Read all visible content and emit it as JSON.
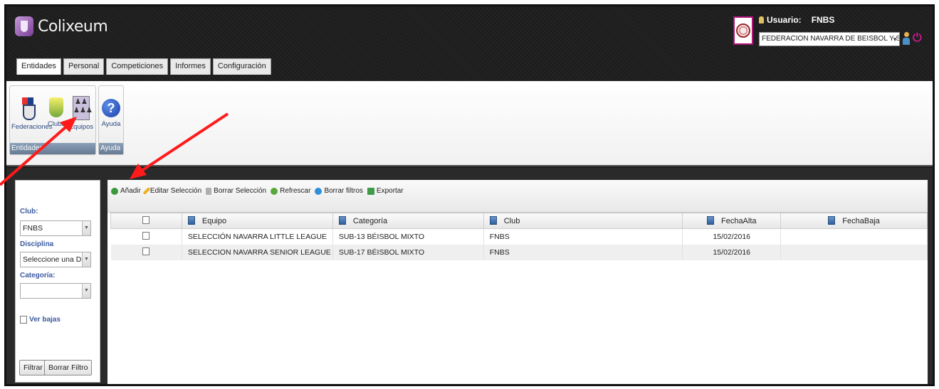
{
  "app": {
    "name": "Colixeum"
  },
  "tabs": [
    {
      "label": "Entidades"
    },
    {
      "label": "Personal"
    },
    {
      "label": "Competiciones"
    },
    {
      "label": "Informes"
    },
    {
      "label": "Configuración"
    }
  ],
  "user": {
    "label": "Usuario:",
    "name": "FNBS",
    "federation_selected": "FEDERACION NAVARRA DE BEISBOL Y SOFBOL"
  },
  "ribbon": {
    "groups": [
      {
        "label": "Entidades",
        "buttons": [
          {
            "label": "Federaciones",
            "icon": "federation-shield-icon"
          },
          {
            "label": "Clubs",
            "icon": "club-shield-icon"
          },
          {
            "label": "Equipos",
            "icon": "team-pieces-icon"
          }
        ]
      },
      {
        "label": "Ayuda",
        "buttons": [
          {
            "label": "Ayuda",
            "icon": "help-icon"
          }
        ]
      }
    ]
  },
  "filters": {
    "club_label": "Club:",
    "club_value": "FNBS",
    "discipline_label": "Disciplina",
    "discipline_value": "Seleccione una Disciplina",
    "category_label": "Categoría:",
    "category_value": "",
    "show_removed_label": "Ver bajas",
    "filter_button": "Filtrar",
    "clear_filter_button": "Borrar Filtro"
  },
  "toolbar": {
    "add": "Añadir",
    "edit": "Editar Selección",
    "delete": "Borrar Selección",
    "refresh": "Refrescar",
    "clear_filters": "Borrar filtros",
    "export": "Exportar"
  },
  "grid": {
    "columns": [
      "Equipo",
      "Categoría",
      "Club",
      "FechaAlta",
      "FechaBaja"
    ],
    "rows": [
      [
        "SELECCIÓN NAVARRA LITTLE LEAGUE",
        "SUB-13 BÉISBOL MIXTO",
        "FNBS",
        "15/02/2016",
        ""
      ],
      [
        "SELECCION NAVARRA SENIOR LEAGUE",
        "SUB-17 BÉISBOL MIXTO",
        "FNBS",
        "15/02/2016",
        ""
      ]
    ]
  },
  "colors": {
    "header_bg": "#1e1e1e",
    "label_blue": "#3b5aa0",
    "annotation_red": "#ff1a1a",
    "brand_purple": "#7a3f96"
  }
}
